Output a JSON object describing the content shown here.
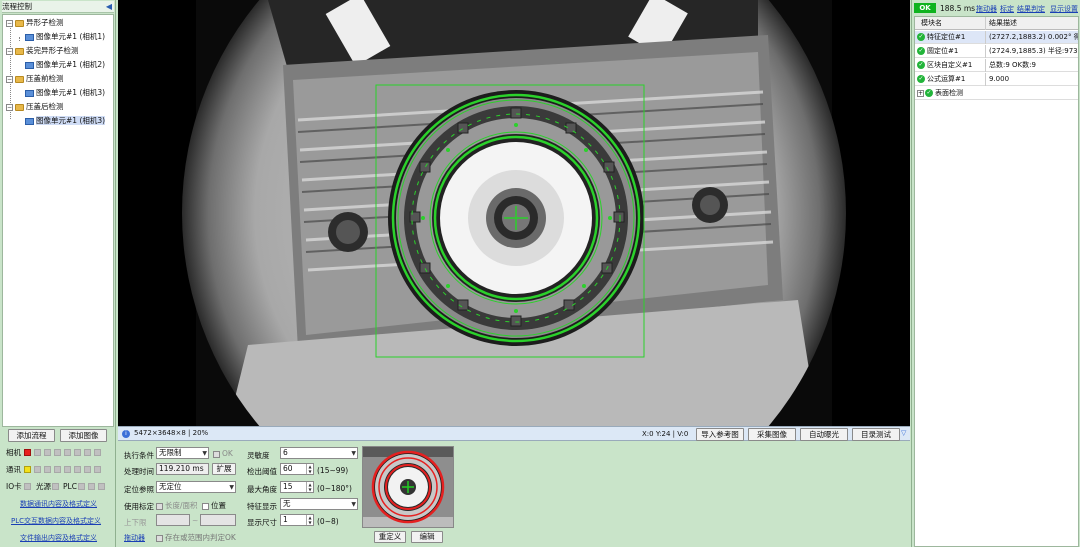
{
  "left": {
    "title": "流程控制",
    "tree": [
      {
        "label": "异形子检测",
        "kind": "group"
      },
      {
        "label": "图像单元#1 (相机1)",
        "kind": "unit"
      },
      {
        "label": "装完异形子检测",
        "kind": "group"
      },
      {
        "label": "图像单元#1 (相机2)",
        "kind": "unit"
      },
      {
        "label": "压盖前检测",
        "kind": "group"
      },
      {
        "label": "图像单元#1 (相机3)",
        "kind": "unit"
      },
      {
        "label": "压盖后检测",
        "kind": "group"
      },
      {
        "label": "图像单元#1 (相机3)",
        "kind": "unit",
        "selected": true
      }
    ],
    "add_flow_button": "添加流程",
    "add_image_button": "添加图像",
    "status": {
      "camera": "相机",
      "comm": "通讯",
      "io": "IO卡",
      "light": "光源",
      "plc": "PLC"
    },
    "colors": {
      "camera": "#e8211e",
      "comm": "#f2e11a",
      "idle": "#c0c0c0"
    },
    "links": [
      "数据通讯内容及格式定义",
      "PLC交互数据内容及格式定义",
      "文件输出内容及格式定义"
    ]
  },
  "center": {
    "image_info": "5472×3648×8 | 20%",
    "coord": "X:0  Y:24 | V:0",
    "buttons": [
      "导入参考图",
      "采集图像",
      "自动曝光",
      "目录测试"
    ]
  },
  "bottom": {
    "exec_condition_label": "执行条件",
    "exec_condition_value": "无限制",
    "ok_label": "OK",
    "process_time_label": "处理时间",
    "process_time_value": "119.210 ms",
    "expand_button": "扩展",
    "locate_ref_label": "定位参照",
    "locate_ref_value": "无定位",
    "use_calib_label": "使用标定",
    "length_area_label": "长度/面积",
    "position_label": "位置",
    "range_label": "上下限",
    "range_sep": "~",
    "drag_label": "拖动器",
    "range_check_label": "存在或范围内判定OK",
    "sensitivity_label": "灵敏度",
    "sensitivity_value": "6",
    "threshold_label": "检出阈值",
    "threshold_value": "60",
    "threshold_range": "(15~99)",
    "max_angle_label": "最大角度",
    "max_angle_value": "15",
    "max_angle_range": "(0~180°)",
    "feature_display_label": "特征显示",
    "feature_display_value": "无",
    "display_size_label": "显示尺寸",
    "display_size_value": "1",
    "display_size_range": "(0~8)",
    "redefine_button": "重定义",
    "edit_button": "编辑"
  },
  "right": {
    "status": "OK",
    "time": "188.5 ms",
    "links": [
      "拖动器",
      "标定",
      "结果判定",
      "显示设置"
    ],
    "columns": [
      "模块名",
      "结果描述"
    ],
    "rows": [
      {
        "name": "特征定位#1",
        "result": "(2727.2,1883.2) 0.002° 得分:99",
        "selected": true
      },
      {
        "name": "圆定位#1",
        "result": "(2724.9,1885.3) 半径:973.5"
      },
      {
        "name": "区块自定义#1",
        "result": "总数:9 OK数:9"
      },
      {
        "name": "公式运算#1",
        "result": "9.000"
      },
      {
        "name": "表面检测",
        "result": "",
        "collapsed": true
      }
    ]
  }
}
